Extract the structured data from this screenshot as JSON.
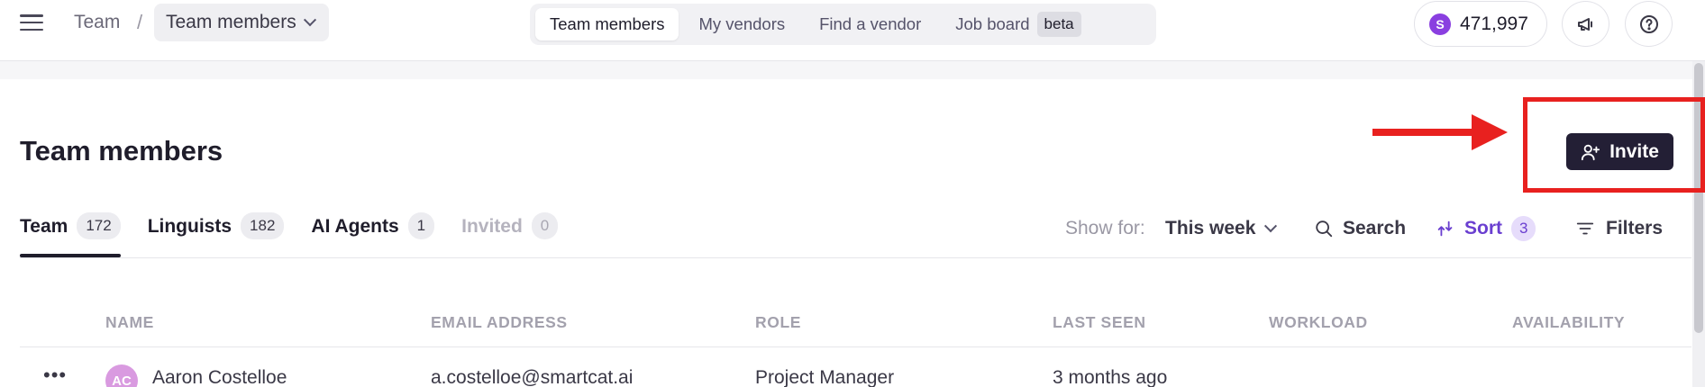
{
  "breadcrumb": {
    "root": "Team",
    "separator": "/",
    "current": "Team members"
  },
  "nav_tabs": [
    {
      "label": "Team members",
      "active": true
    },
    {
      "label": "My vendors",
      "active": false
    },
    {
      "label": "Find a vendor",
      "active": false
    },
    {
      "label": "Job board",
      "active": false,
      "badge": "beta"
    }
  ],
  "credits": {
    "icon_letter": "S",
    "value": "471,997",
    "color": "#8a3fe0"
  },
  "header_icons": [
    "megaphone-icon",
    "help-icon"
  ],
  "page_title": "Team members",
  "invite_button": {
    "label": "Invite",
    "icon": "user-plus-icon",
    "color": "#231f35"
  },
  "annotation": {
    "color": "#e8211f",
    "shapes": [
      "arrow",
      "box"
    ]
  },
  "tabs": [
    {
      "label": "Team",
      "count": "172",
      "active": true
    },
    {
      "label": "Linguists",
      "count": "182",
      "active": false
    },
    {
      "label": "AI Agents",
      "count": "1",
      "active": false
    },
    {
      "label": "Invited",
      "count": "0",
      "active": false,
      "muted": true
    }
  ],
  "controls": {
    "show_for_label": "Show for:",
    "show_for_value": "This week",
    "search_label": "Search",
    "sort_label": "Sort",
    "sort_count": "3",
    "filters_label": "Filters",
    "accent": "#6a3fd0"
  },
  "table": {
    "columns": [
      "NAME",
      "EMAIL ADDRESS",
      "ROLE",
      "LAST SEEN",
      "WORKLOAD",
      "AVAILABILITY"
    ],
    "rows": [
      {
        "initials": "AC",
        "name": "Aaron Costelloe",
        "email": "a.costelloe@smartcat.ai",
        "role": "Project Manager",
        "last_seen": "3 months ago"
      }
    ]
  }
}
